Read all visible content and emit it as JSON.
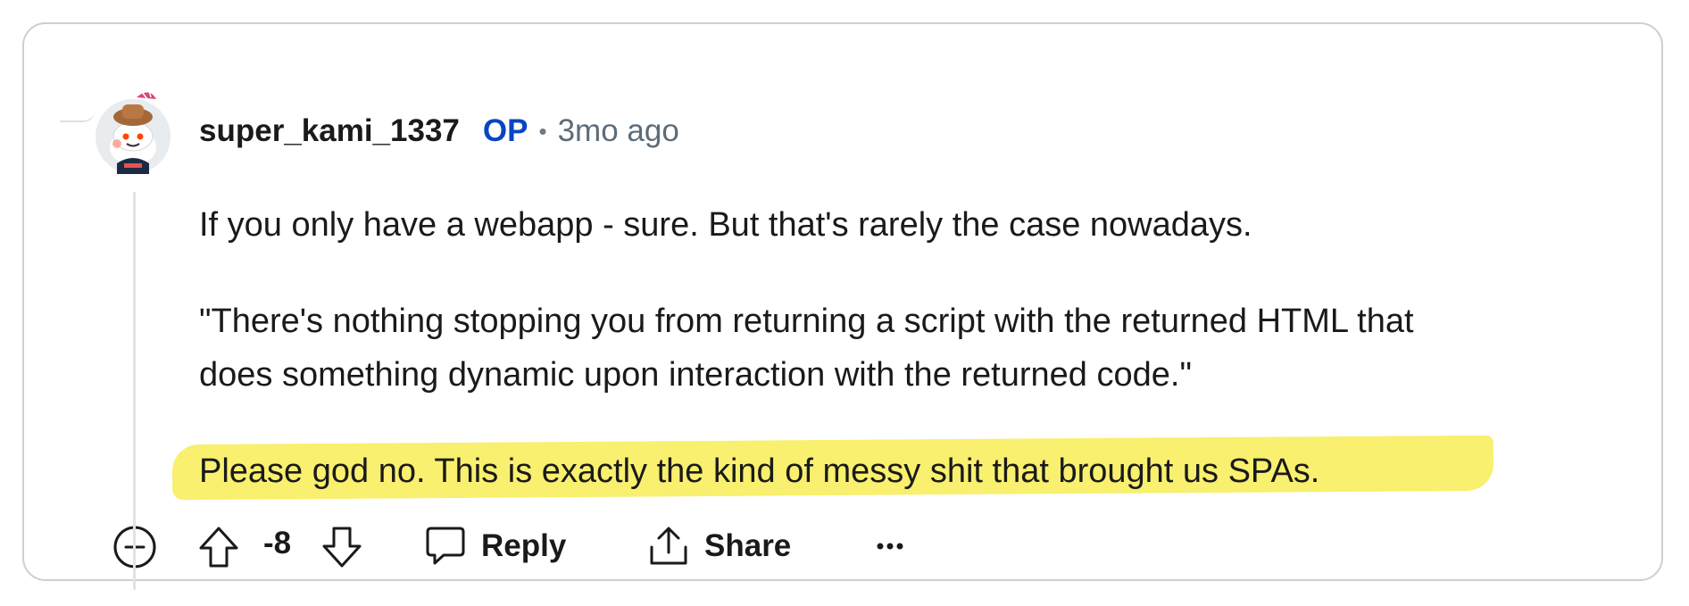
{
  "comment": {
    "author": "super_kami_1337",
    "op_badge": "OP",
    "separator": "•",
    "timestamp": "3mo ago",
    "paragraphs": {
      "p1": "If you only have a webapp - sure. But that's rarely the case nowadays.",
      "p2_line1": "\"There's nothing stopping you from returning a script with the returned HTML that",
      "p2_line2": "does something dynamic upon interaction with the returned code.\"",
      "p3": "Please god no. This is exactly the kind of messy shit that brought us SPAs."
    },
    "highlight_color": "#f8f06e"
  },
  "actions": {
    "collapse_icon": "collapse-minus-icon",
    "upvote_icon": "upvote-arrow-icon",
    "score": "-8",
    "downvote_icon": "downvote-arrow-icon",
    "reply_icon": "speech-bubble-icon",
    "reply_label": "Reply",
    "share_icon": "share-upload-icon",
    "share_label": "Share",
    "more_icon": "more-dots-icon"
  },
  "colors": {
    "op": "#0a45c2",
    "meta": "#5c6c7a",
    "border": "#cfcfcf"
  }
}
